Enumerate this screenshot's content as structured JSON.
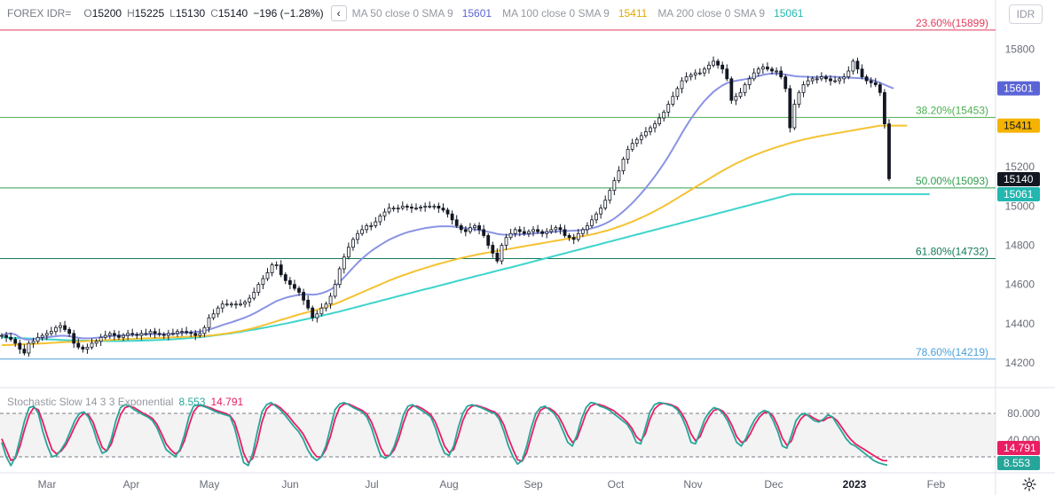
{
  "header": {
    "symbol": "FOREX IDR=",
    "open_key": "O",
    "open": "15200",
    "high_key": "H",
    "high": "15225",
    "low_key": "L",
    "low": "15130",
    "close_key": "C",
    "close": "15140",
    "change": "−196 (−1.28%)",
    "collapse_icon": "chevron-left-icon",
    "ma1_label": "MA 50 close 0 SMA 9",
    "ma1_value": "15601",
    "ma2_label": "MA 100 close 0 SMA 9",
    "ma2_value": "15411",
    "ma3_label": "MA 200 close 0 SMA 9",
    "ma3_value": "15061"
  },
  "currency_button": "IDR",
  "colors": {
    "up": "#131722",
    "down": "#131722",
    "ma50": "#8b93e3",
    "ma100": "#f5c232",
    "ma200": "#3ed4cc",
    "fib236": "#e03a58",
    "fib382": "#4caf50",
    "fib500": "#2e9c4d",
    "fib618": "#137a5a",
    "fib786": "#4a9fd8",
    "stoch_k": "#26a69a",
    "stoch_d": "#e91e63"
  },
  "chart_data": {
    "type": "candlestick",
    "price_axis": {
      "ticks": [
        14200,
        14400,
        14600,
        14800,
        15000,
        15200,
        15800
      ],
      "range": [
        14100,
        15920
      ]
    },
    "time_axis": {
      "labels": [
        "Mar",
        "Apr",
        "May",
        "Jun",
        "Jul",
        "Aug",
        "Sep",
        "Oct",
        "Nov",
        "Dec",
        "2023",
        "Feb"
      ]
    },
    "fib_levels": [
      {
        "label": "23.60%(15899)",
        "value": 15899
      },
      {
        "label": "38.20%(15453)",
        "value": 15453
      },
      {
        "label": "50.00%(15093)",
        "value": 15093
      },
      {
        "label": "61.80%(14732)",
        "value": 14732
      },
      {
        "label": "78.60%(14219)",
        "value": 14219
      }
    ],
    "price_labels": [
      {
        "text": "15601",
        "value": 15601,
        "series": "ma50"
      },
      {
        "text": "15411",
        "value": 15411,
        "series": "ma100"
      },
      {
        "text": "15140",
        "value": 15140,
        "series": "last"
      },
      {
        "text": "15061",
        "value": 15061,
        "series": "ma200"
      }
    ],
    "closes": [
      14340,
      14330,
      14320,
      14300,
      14270,
      14250,
      14300,
      14310,
      14330,
      14340,
      14350,
      14360,
      14380,
      14390,
      14370,
      14350,
      14300,
      14280,
      14270,
      14280,
      14300,
      14310,
      14330,
      14340,
      14350,
      14340,
      14330,
      14340,
      14350,
      14345,
      14340,
      14350,
      14350,
      14360,
      14350,
      14345,
      14340,
      14350,
      14350,
      14360,
      14360,
      14355,
      14350,
      14340,
      14350,
      14380,
      14430,
      14450,
      14480,
      14500,
      14500,
      14500,
      14500,
      14500,
      14510,
      14530,
      14560,
      14600,
      14630,
      14660,
      14700,
      14700,
      14650,
      14620,
      14600,
      14580,
      14560,
      14520,
      14480,
      14430,
      14450,
      14480,
      14500,
      14540,
      14600,
      14680,
      14740,
      14790,
      14830,
      14860,
      14880,
      14900,
      14900,
      14920,
      14950,
      14970,
      14990,
      14990,
      14990,
      15000,
      14995,
      14990,
      14990,
      14995,
      15000,
      15000,
      15000,
      14990,
      14980,
      14960,
      14930,
      14900,
      14880,
      14870,
      14890,
      14900,
      14880,
      14850,
      14800,
      14760,
      14720,
      14800,
      14840,
      14860,
      14880,
      14870,
      14860,
      14870,
      14880,
      14870,
      14860,
      14870,
      14880,
      14890,
      14880,
      14850,
      14840,
      14830,
      14860,
      14880,
      14900,
      14930,
      14960,
      14990,
      15030,
      15080,
      15130,
      15180,
      15240,
      15290,
      15320,
      15340,
      15360,
      15380,
      15400,
      15420,
      15450,
      15480,
      15520,
      15560,
      15600,
      15640,
      15660,
      15670,
      15680,
      15680,
      15700,
      15720,
      15740,
      15720,
      15700,
      15650,
      15540,
      15560,
      15580,
      15620,
      15650,
      15680,
      15700,
      15710,
      15700,
      15690,
      15690,
      15660,
      15600,
      15400,
      15520,
      15580,
      15620,
      15640,
      15650,
      15650,
      15660,
      15650,
      15640,
      15640,
      15650,
      15660,
      15690,
      15740,
      15700,
      15660,
      15640,
      15630,
      15620,
      15580,
      15420,
      15140
    ],
    "ma50": [
      14340,
      14348,
      14350,
      14345,
      14330,
      14320,
      14318,
      14320,
      14325,
      14328,
      14330,
      14333,
      14336,
      14338,
      14338,
      14336,
      14332,
      14328,
      14325,
      14325,
      14326,
      14328,
      14330,
      14333,
      14336,
      14338,
      14339,
      14340,
      14341,
      14342,
      14343,
      14344,
      14345,
      14346,
      14346,
      14346,
      14346,
      14347,
      14348,
      14350,
      14352,
      14354,
      14356,
      14358,
      14360,
      14364,
      14370,
      14377,
      14385,
      14393,
      14400,
      14407,
      14415,
      14423,
      14431,
      14441,
      14452,
      14464,
      14477,
      14490,
      14503,
      14515,
      14524,
      14532,
      14538,
      14543,
      14547,
      14549,
      14549,
      14548,
      14550,
      14555,
      14563,
      14574,
      14590,
      14612,
      14636,
      14661,
      14686,
      14710,
      14732,
      14752,
      14770,
      14786,
      14801,
      14815,
      14828,
      14839,
      14849,
      14858,
      14866,
      14872,
      14878,
      14883,
      14888,
      14891,
      14894,
      14896,
      14897,
      14897,
      14896,
      14893,
      14890,
      14887,
      14884,
      14881,
      14878,
      14874,
      14869,
      14864,
      14858,
      14855,
      14854,
      14854,
      14855,
      14856,
      14857,
      14858,
      14860,
      14862,
      14864,
      14866,
      14868,
      14870,
      14872,
      14873,
      14874,
      14875,
      14876,
      14878,
      14882,
      14887,
      14893,
      14901,
      14911,
      14923,
      14937,
      14954,
      14973,
      14994,
      15016,
      15040,
      15066,
      15093,
      15122,
      15152,
      15184,
      15218,
      15254,
      15292,
      15332,
      15372,
      15410,
      15445,
      15478,
      15509,
      15537,
      15561,
      15583,
      15601,
      15616,
      15628,
      15635,
      15640,
      15644,
      15648,
      15652,
      15658,
      15664,
      15670,
      15674,
      15677,
      15678,
      15676,
      15672,
      15668,
      15664,
      15662,
      15661,
      15660,
      15659,
      15659,
      15660,
      15661,
      15661,
      15660,
      15659,
      15657,
      15656,
      15655,
      15654,
      15653,
      15650,
      15645,
      15638,
      15630,
      15620,
      15610,
      15601
    ],
    "ma100": [
      14290,
      14291,
      14292,
      14293,
      14294,
      14295,
      14296,
      14297,
      14298,
      14299,
      14300,
      14302,
      14303,
      14305,
      14306,
      14307,
      14308,
      14309,
      14310,
      14311,
      14312,
      14313,
      14314,
      14315,
      14317,
      14318,
      14319,
      14320,
      14321,
      14322,
      14323,
      14324,
      14325,
      14326,
      14327,
      14327,
      14328,
      14329,
      14330,
      14331,
      14332,
      14333,
      14334,
      14335,
      14336,
      14337,
      14339,
      14341,
      14344,
      14347,
      14350,
      14354,
      14358,
      14362,
      14367,
      14372,
      14378,
      14384,
      14391,
      14398,
      14405,
      14412,
      14419,
      14426,
      14433,
      14440,
      14447,
      14453,
      14459,
      14465,
      14471,
      14478,
      14485,
      14493,
      14501,
      14510,
      14520,
      14530,
      14540,
      14550,
      14560,
      14570,
      14580,
      14590,
      14600,
      14610,
      14620,
      14629,
      14638,
      14646,
      14654,
      14662,
      14670,
      14677,
      14684,
      14691,
      14698,
      14705,
      14711,
      14717,
      14723,
      14729,
      14735,
      14740,
      14745,
      14750,
      14755,
      14759,
      14763,
      14767,
      14771,
      14775,
      14779,
      14783,
      14787,
      14791,
      14795,
      14799,
      14803,
      14807,
      14811,
      14815,
      14819,
      14823,
      14827,
      14831,
      14835,
      14839,
      14843,
      14847,
      14851,
      14856,
      14861,
      14867,
      14873,
      14880,
      14887,
      14895,
      14903,
      14912,
      14921,
      14931,
      14941,
      14952,
      14963,
      14975,
      14987,
      15000,
      15013,
      15027,
      15041,
      15055,
      15069,
      15083,
      15097,
      15111,
      15125,
      15139,
      15153,
      15167,
      15180,
      15193,
      15205,
      15217,
      15228,
      15239,
      15249,
      15259,
      15268,
      15277,
      15285,
      15293,
      15301,
      15308,
      15315,
      15322,
      15328,
      15334,
      15340,
      15345,
      15350,
      15355,
      15359,
      15363,
      15367,
      15371,
      15375,
      15379,
      15383,
      15387,
      15391,
      15395,
      15399,
      15403,
      15407,
      15411,
      15411,
      15411,
      15411,
      15411,
      15411,
      15411
    ],
    "ma200": [
      14330,
      14329,
      14328,
      14327,
      14326,
      14325,
      14324,
      14323,
      14322,
      14321,
      14320,
      14319,
      14318,
      14317,
      14316,
      14315,
      14315,
      14314,
      14313,
      14313,
      14312,
      14312,
      14312,
      14311,
      14311,
      14311,
      14311,
      14311,
      14312,
      14312,
      14313,
      14313,
      14314,
      14315,
      14316,
      14317,
      14318,
      14319,
      14320,
      14322,
      14323,
      14325,
      14327,
      14329,
      14331,
      14333,
      14336,
      14339,
      14342,
      14345,
      14348,
      14351,
      14355,
      14358,
      14362,
      14366,
      14370,
      14374,
      14378,
      14382,
      14387,
      14391,
      14396,
      14400,
      14405,
      14410,
      14415,
      14420,
      14425,
      14430,
      14435,
      14440,
      14446,
      14451,
      14457,
      14462,
      14468,
      14474,
      14480,
      14486,
      14492,
      14498,
      14504,
      14510,
      14516,
      14522,
      14528,
      14534,
      14540,
      14546,
      14552,
      14558,
      14564,
      14570,
      14576,
      14581,
      14587,
      14593,
      14599,
      14605,
      14611,
      14617,
      14623,
      14629,
      14635,
      14641,
      14647,
      14652,
      14658,
      14664,
      14670,
      14676,
      14682,
      14687,
      14693,
      14699,
      14705,
      14711,
      14717,
      14723,
      14729,
      14735,
      14741,
      14747,
      14753,
      14759,
      14765,
      14771,
      14777,
      14783,
      14789,
      14795,
      14801,
      14807,
      14813,
      14819,
      14825,
      14831,
      14837,
      14843,
      14849,
      14855,
      14861,
      14867,
      14873,
      14879,
      14885,
      14891,
      14897,
      14903,
      14909,
      14915,
      14921,
      14927,
      14933,
      14939,
      14945,
      14951,
      14957,
      14963,
      14969,
      14975,
      14981,
      14987,
      14993,
      14999,
      15005,
      15011,
      15017,
      15023,
      15029,
      15035,
      15041,
      15047,
      15053,
      15059,
      15061,
      15061,
      15061,
      15061,
      15061,
      15061,
      15061,
      15061,
      15061,
      15061,
      15061,
      15061,
      15061,
      15061,
      15061,
      15061,
      15061,
      15061,
      15061,
      15061,
      15061,
      15061,
      15061,
      15061,
      15061,
      15061,
      15061,
      15061,
      15061,
      15061,
      15061
    ],
    "stochastic": {
      "title": "Stochastic Slow 14 3 3 Exponential",
      "k_value": "8.553",
      "d_value": "14.791",
      "levels": [
        80,
        20
      ],
      "axis_ticks": [
        "80.000",
        "40.000"
      ],
      "k": [
        40,
        20,
        8,
        20,
        45,
        70,
        88,
        90,
        80,
        55,
        35,
        20,
        22,
        30,
        40,
        55,
        70,
        80,
        82,
        75,
        60,
        40,
        25,
        28,
        45,
        70,
        88,
        92,
        90,
        85,
        82,
        78,
        75,
        70,
        60,
        45,
        30,
        25,
        20,
        30,
        50,
        75,
        90,
        92,
        90,
        88,
        85,
        82,
        80,
        78,
        76,
        60,
        35,
        12,
        8,
        25,
        55,
        82,
        92,
        95,
        90,
        85,
        78,
        70,
        62,
        55,
        45,
        30,
        20,
        15,
        20,
        35,
        60,
        85,
        93,
        95,
        92,
        88,
        85,
        82,
        75,
        60,
        40,
        22,
        18,
        22,
        35,
        55,
        78,
        90,
        92,
        88,
        84,
        80,
        75,
        60,
        40,
        25,
        22,
        35,
        60,
        80,
        90,
        92,
        90,
        88,
        85,
        82,
        80,
        72,
        55,
        35,
        20,
        10,
        15,
        35,
        60,
        80,
        88,
        90,
        85,
        80,
        70,
        55,
        40,
        35,
        50,
        72,
        88,
        95,
        94,
        90,
        88,
        85,
        80,
        75,
        70,
        65,
        55,
        40,
        38,
        60,
        82,
        92,
        95,
        94,
        92,
        90,
        85,
        75,
        60,
        40,
        38,
        55,
        72,
        82,
        88,
        86,
        80,
        70,
        55,
        40,
        35,
        45,
        60,
        72,
        80,
        84,
        82,
        70,
        55,
        35,
        32,
        50,
        70,
        78,
        80,
        75,
        70,
        68,
        72,
        78,
        75,
        65,
        55,
        45,
        38,
        35,
        30,
        25,
        20,
        15,
        12,
        10,
        8.553
      ],
      "d": [
        45,
        30,
        15,
        18,
        35,
        58,
        78,
        88,
        85,
        68,
        48,
        30,
        24,
        28,
        36,
        48,
        62,
        74,
        80,
        78,
        68,
        50,
        33,
        28,
        38,
        58,
        78,
        88,
        90,
        88,
        84,
        80,
        77,
        73,
        65,
        52,
        38,
        30,
        24,
        28,
        42,
        63,
        82,
        90,
        91,
        89,
        87,
        84,
        82,
        80,
        77,
        68,
        48,
        25,
        12,
        18,
        40,
        68,
        86,
        92,
        92,
        88,
        82,
        75,
        67,
        60,
        52,
        40,
        28,
        20,
        20,
        30,
        48,
        72,
        88,
        93,
        93,
        90,
        87,
        84,
        79,
        68,
        52,
        33,
        22,
        22,
        30,
        46,
        67,
        84,
        90,
        90,
        87,
        83,
        78,
        68,
        52,
        35,
        26,
        30,
        48,
        70,
        84,
        90,
        91,
        89,
        87,
        84,
        82,
        76,
        64,
        46,
        30,
        16,
        14,
        26,
        48,
        70,
        84,
        88,
        87,
        83,
        76,
        64,
        50,
        40,
        45,
        62,
        80,
        90,
        93,
        92,
        90,
        87,
        84,
        79,
        74,
        68,
        60,
        48,
        42,
        52,
        72,
        86,
        92,
        94,
        93,
        91,
        88,
        80,
        68,
        52,
        42,
        48,
        64,
        76,
        84,
        86,
        83,
        75,
        63,
        48,
        40,
        42,
        52,
        65,
        75,
        81,
        82,
        76,
        63,
        46,
        36,
        42,
        60,
        72,
        78,
        77,
        73,
        70,
        70,
        74,
        75,
        70,
        61,
        52,
        44,
        38,
        34,
        30,
        26,
        22,
        18,
        15,
        14.791
      ]
    }
  }
}
